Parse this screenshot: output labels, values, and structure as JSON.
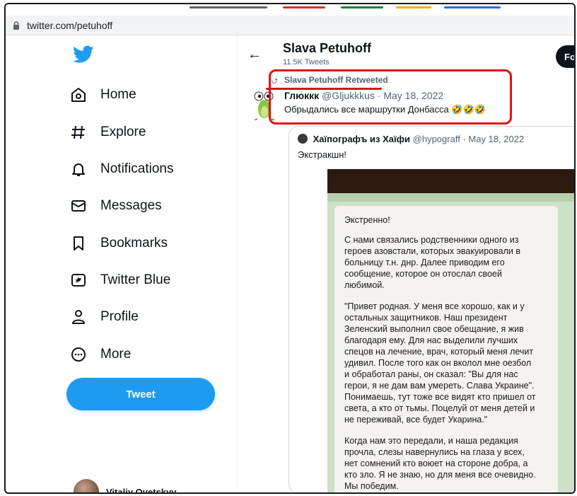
{
  "browser": {
    "url": "twitter.com/petuhoff"
  },
  "sidebar": {
    "items": [
      {
        "label": "Home",
        "icon": "home-icon"
      },
      {
        "label": "Explore",
        "icon": "hashtag-icon"
      },
      {
        "label": "Notifications",
        "icon": "bell-icon"
      },
      {
        "label": "Messages",
        "icon": "envelope-icon"
      },
      {
        "label": "Bookmarks",
        "icon": "bookmark-icon"
      },
      {
        "label": "Twitter Blue",
        "icon": "twitter-blue-icon"
      },
      {
        "label": "Profile",
        "icon": "person-icon"
      },
      {
        "label": "More",
        "icon": "more-circle-icon"
      }
    ],
    "tweet_button": "Tweet",
    "account_name": "Vitaliy Ovetskyy",
    "account_more": "..."
  },
  "profile": {
    "name": "Slava Petuhoff",
    "tweets_count": "11.5K Tweets",
    "follow_label": "Fo"
  },
  "tweet": {
    "retweet_label": "Slava Petuhoff Retweeted",
    "author_name": "Глюккк",
    "author_handle": "@Gljukkkus",
    "date": "· May 18, 2022",
    "text": "Обрыдались все маршрутки Донбасса 🤣🤣🤣"
  },
  "quote": {
    "author_name": "Хаїпографъ из Хаїфи",
    "author_handle": "@hypograff",
    "date": "· May 18, 2022",
    "text": "Экстракшн!",
    "image_text": {
      "title": "Экстренно!",
      "p1": "С нами связались родственники одного из\nгероев азовстали, которых эвакуировали в\nбольницу т.н. днр. Далее приводим его\nсообщение, которое он отослал своей\nлюбимой.",
      "p2": "\"Привет родная. У меня все хорошо, как и у\nостальных защитников. Наш президент\nЗеленский выполнил свое обещание, я жив\nблагодаря ему. Для нас выделили лучших\nспецов на лечение, врач, который меня лечит\nудивил. После того как он вколол мне оезбол\nи обработал раны, он сказал: \"Вы для нас\nгерои, я не дам вам умереть. Слава Украине\".\nПонимаешь, тут тоже все видят кто пришел от\nсвета, а кто от тьмы. Поцелуй от меня детей и\nне переживай, все будет Укарина.\"",
      "p3": "Когда нам это передали, и наша редакция\nпрочла, слезы навернулись на глаза у всех,\nнет сомнений кто воюет на стороне добра, а\nкто зло. Я не знаю, но для меня все очевидно.\nМы победим."
    }
  },
  "colors": {
    "accent": "#1d9bf0",
    "highlight": "#e0101a"
  }
}
